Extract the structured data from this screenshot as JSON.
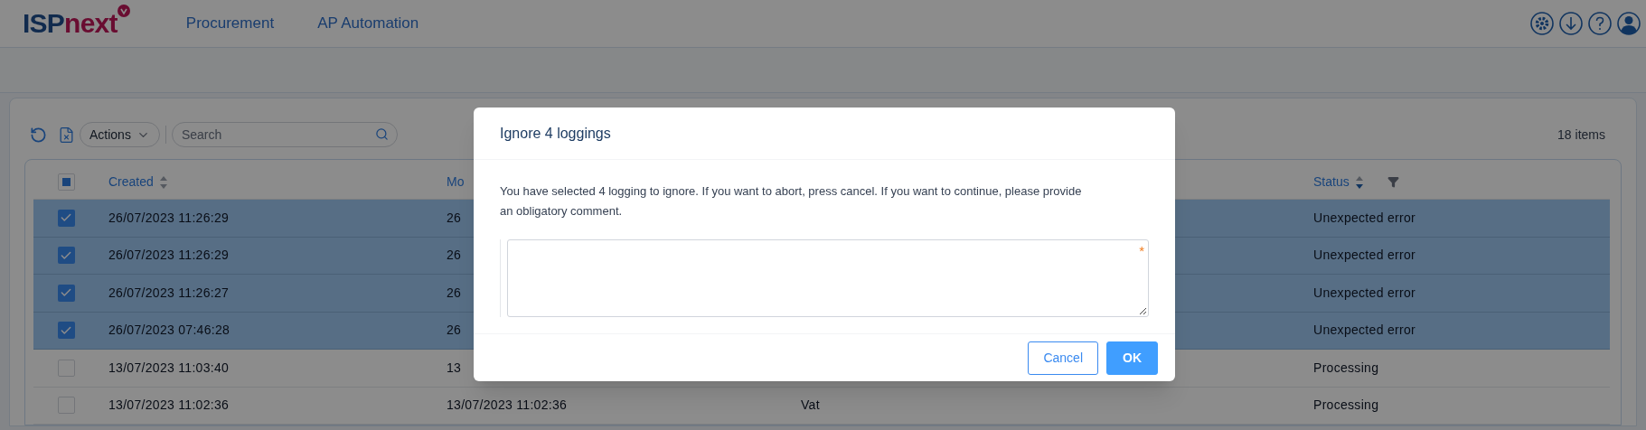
{
  "header": {
    "logo": {
      "part_1": "ISP",
      "part_2": "next"
    },
    "nav": [
      {
        "label": "Procurement"
      },
      {
        "label": "AP Automation"
      }
    ]
  },
  "toolbar": {
    "actions_label": "Actions",
    "search": {
      "placeholder": "Search"
    },
    "item_count": "18 items"
  },
  "table": {
    "select_all": {
      "indeterminate": true
    },
    "columns": [
      {
        "label": "Created",
        "sorted_descending": false
      },
      {
        "label": "Mo"
      },
      {},
      {
        "label": "Status",
        "sorted_descending": true,
        "filter": true
      }
    ],
    "rows": [
      {
        "selected": true,
        "cells": [
          "26/07/2023 11:26:29",
          "26",
          null,
          "Unexpected error"
        ]
      },
      {
        "selected": true,
        "cells": [
          "26/07/2023 11:26:29",
          "26",
          null,
          "Unexpected error"
        ]
      },
      {
        "selected": true,
        "cells": [
          "26/07/2023 11:26:27",
          "26",
          null,
          "Unexpected error"
        ]
      },
      {
        "selected": true,
        "cells": [
          "26/07/2023 07:46:28",
          "26",
          null,
          "Unexpected error"
        ]
      },
      {
        "selected": false,
        "cells": [
          "13/07/2023 11:03:40",
          "13",
          null,
          "Processing"
        ]
      },
      {
        "selected": false,
        "cells": [
          "13/07/2023 11:02:36",
          "13/07/2023 11:02:36",
          "Vat",
          "Processing"
        ]
      }
    ]
  },
  "dialog": {
    "title": "Ignore 4 loggings",
    "message": "You have selected 4 logging to ignore. If you want to abort, press cancel. If you want to continue, please provide an obligatory comment.",
    "comment": {
      "required": true,
      "required_mark": "*"
    },
    "buttons": [
      {
        "kind": "secondary",
        "label": "Cancel"
      },
      {
        "kind": "primary",
        "label": "OK"
      }
    ]
  }
}
